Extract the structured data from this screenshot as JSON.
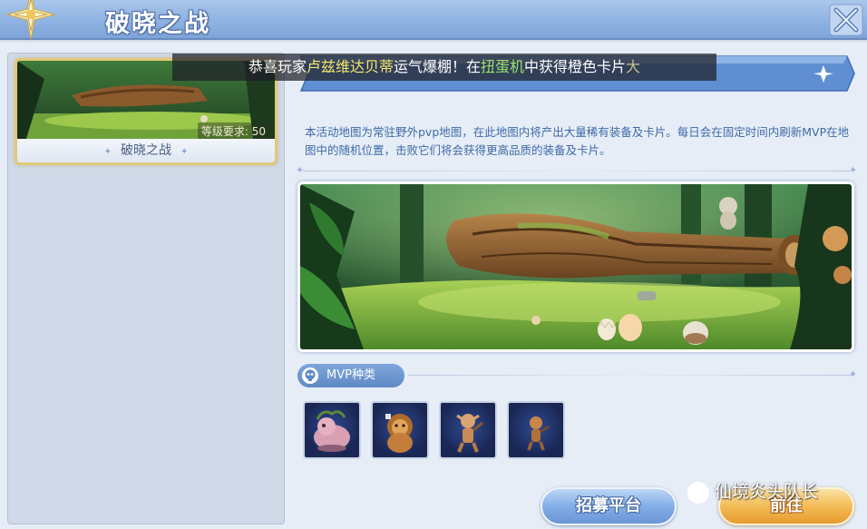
{
  "header": {
    "title": "破晓之战"
  },
  "map_list": {
    "items": [
      {
        "name": "破晓之战",
        "level_requirement": "等级要求: 50",
        "selected": true
      }
    ]
  },
  "ticker": {
    "prefix": "恭喜玩家",
    "player_name": "卢兹维达贝蒂",
    "middle": "运气爆棚！在",
    "machine": "扭蛋机",
    "suffix": "中获得橙色卡片",
    "trailing": "大"
  },
  "description": "本活动地图为常驻野外pvp地图，在此地图内将产出大量稀有装备及卡片。每日会在固定时间内刷新MVP在地图中的随机位置，击败它们将会获得更高品质的装备及卡片。",
  "mvp_section": {
    "label": "MVP种类",
    "monsters": [
      {
        "icon": "pink-beast-icon"
      },
      {
        "icon": "lion-beast-icon"
      },
      {
        "icon": "goblin-icon"
      },
      {
        "icon": "small-goblin-icon"
      }
    ]
  },
  "buttons": {
    "recruit": "招募平台",
    "go": "前往"
  },
  "watermark": "仙境炎头队长",
  "colors": {
    "header_blue": "#8fb3e2",
    "selected_gold": "#e2c878",
    "description_text": "#3f6aa8",
    "go_orange": "#f3bc55",
    "recruit_blue": "#84aee6"
  }
}
